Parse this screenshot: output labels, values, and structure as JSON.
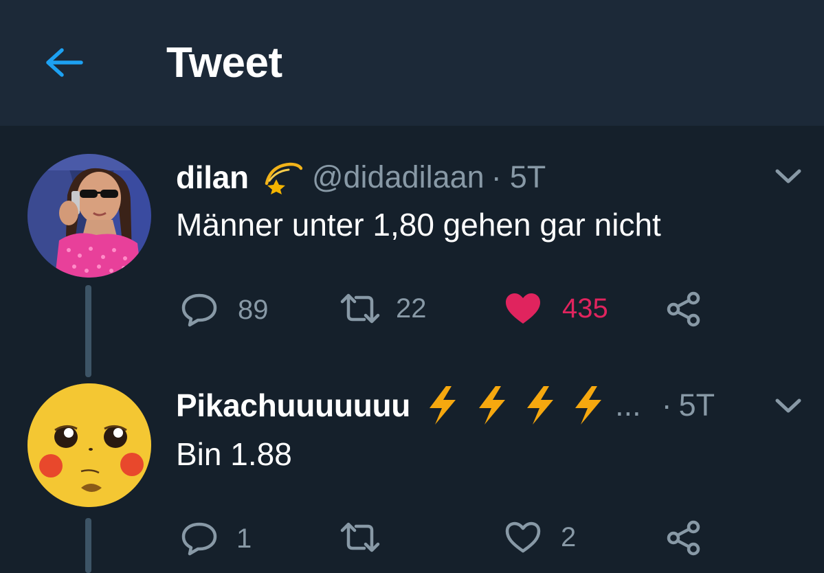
{
  "header": {
    "title": "Tweet",
    "back_icon": "arrow-left-icon",
    "accent_color": "#1da1f2"
  },
  "tweets": [
    {
      "display_name": "dilan",
      "name_emoji": "shooting-star-icon",
      "handle": "@didadilaan",
      "separator": "·",
      "time": "5T",
      "text": "Männer unter 1,80 gehen gar nicht",
      "avatar": "avatar-girl-pink-top",
      "actions": {
        "reply_count": "89",
        "retweet_count": "22",
        "like_count": "435",
        "liked": true
      }
    },
    {
      "display_name": "Pikachuuuuuuu",
      "name_emoji": "lightning-bolt-icon",
      "name_emoji_repeat": 4,
      "ellipsis": "...",
      "separator": "·",
      "time": "5T",
      "text": "Bin 1.88",
      "avatar": "avatar-pikachu",
      "actions": {
        "reply_count": "1",
        "retweet_count": "",
        "like_count": "2",
        "liked": false
      }
    }
  ],
  "colors": {
    "background": "#15202b",
    "header_background": "#1c2938",
    "secondary_text": "#8899a6",
    "like_active": "#e0245e",
    "thread_line": "#3d5466"
  }
}
